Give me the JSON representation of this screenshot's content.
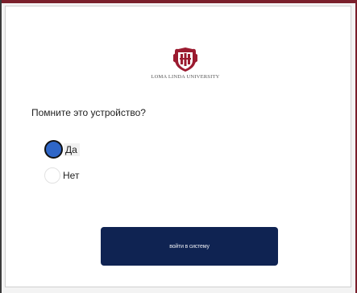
{
  "logo": {
    "crest_icon": "university-crest-icon",
    "text": "LOMA LINDA UNIVERSITY",
    "crest_color": "#9b1b30"
  },
  "question": "Помните это устройство?",
  "options": [
    {
      "label": "Да",
      "checked": true
    },
    {
      "label": "Нет",
      "checked": false
    }
  ],
  "submit_button": {
    "label": "войти в систему",
    "color": "#0f2352"
  },
  "colors": {
    "accent_border": "#7a1f2b",
    "radio_selected": "#2f66c7"
  }
}
